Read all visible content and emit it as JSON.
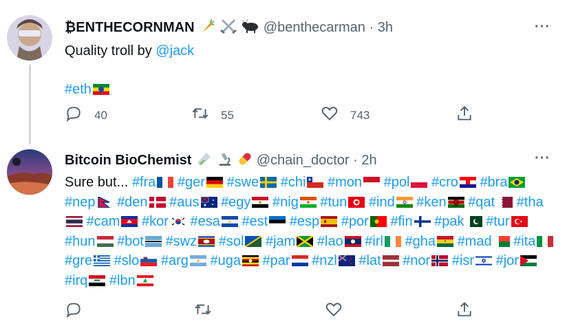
{
  "tweets": [
    {
      "author_name": "₿ENTHECORNMAN",
      "author_emojis": [
        "carrot-icon",
        "crossed-swords-icon",
        "ox-icon"
      ],
      "handle": "@benthecarman",
      "separator": "·",
      "time": "3h",
      "text_prefix": "Quality troll by ",
      "mention": "@jack",
      "hashtag": "#eth",
      "reply_count": "40",
      "retweet_count": "55",
      "like_count": "743"
    },
    {
      "author_name": "Bitcoin BioChemist",
      "author_emojis": [
        "test-tube-icon",
        "microscope-icon",
        "pill-icon"
      ],
      "handle": "@chain_doctor",
      "separator": "·",
      "time": "2h",
      "text_prefix": "Sure but... ",
      "hashtags": [
        "#fra",
        "#ger",
        "#swe",
        "#chi",
        "#mon",
        "#pol",
        "#cro",
        "#bra",
        "#nep",
        "#den",
        "#aus",
        "#egy",
        "#nig",
        "#tun",
        "#ind",
        "#ken",
        "#qat",
        "#tha",
        "#cam",
        "#kor",
        "#esa",
        "#est",
        "#esp",
        "#por",
        "#fin",
        "#pak",
        "#tur",
        "#hun",
        "#bot",
        "#swz",
        "#sol",
        "#jam",
        "#lao",
        "#irl",
        "#gha",
        "#mad",
        "#ita",
        "#gre",
        "#slo",
        "#arg",
        "#uga",
        "#par",
        "#nzl",
        "#lat",
        "#nor",
        "#isr",
        "#jor",
        "#irq",
        "#lbn"
      ],
      "reply_count": "",
      "retweet_count": "",
      "like_count": ""
    }
  ],
  "colors": {
    "link": "#1d9bf0",
    "muted": "#536471",
    "text": "#0f1419"
  }
}
